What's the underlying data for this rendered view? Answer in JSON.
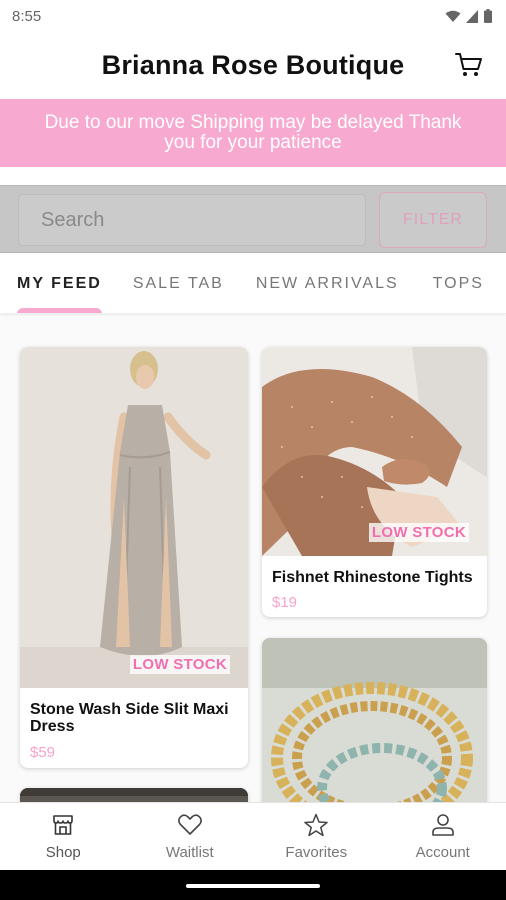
{
  "status_bar": {
    "time": "8:55"
  },
  "header": {
    "title": "Brianna Rose Boutique"
  },
  "banner": {
    "text": "Due to our move Shipping may be delayed Thank you for your patience"
  },
  "search": {
    "placeholder": "Search",
    "filter_label": "FILTER"
  },
  "tabs": [
    {
      "label": "MY FEED",
      "active": true
    },
    {
      "label": "SALE TAB",
      "active": false
    },
    {
      "label": "NEW ARRIVALS",
      "active": false
    },
    {
      "label": "TOPS",
      "active": false
    }
  ],
  "products": [
    {
      "title": "Stone Wash Side Slit Maxi Dress",
      "price": "$59",
      "badge": "LOW STOCK"
    },
    {
      "title": "Fishnet Rhinestone Tights",
      "price": "$19",
      "badge": "LOW STOCK"
    }
  ],
  "bottom_nav": [
    {
      "label": "Shop",
      "icon": "shop-icon",
      "active": true
    },
    {
      "label": "Waitlist",
      "icon": "heart-icon",
      "active": false
    },
    {
      "label": "Favorites",
      "icon": "star-icon",
      "active": false
    },
    {
      "label": "Account",
      "icon": "person-icon",
      "active": false
    }
  ],
  "colors": {
    "accent_pink": "#f7a9d0",
    "badge_pink": "#f06fb0",
    "price_pink": "#f5a4cb"
  }
}
